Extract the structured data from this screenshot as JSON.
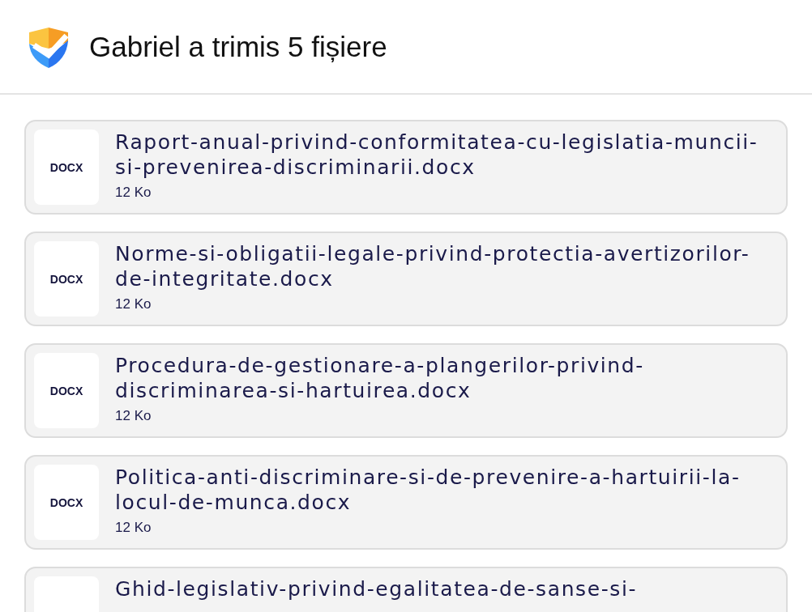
{
  "header": {
    "title": "Gabriel a trimis 5 fișiere"
  },
  "files": [
    {
      "type": "DOCX",
      "name": "Raport-anual-privind-conformitatea-cu-legislatia-muncii-si-prevenirea-discriminarii.docx",
      "size": "12 Ko"
    },
    {
      "type": "DOCX",
      "name": "Norme-si-obligatii-legale-privind-protectia-avertizorilor-de-integritate.docx",
      "size": "12 Ko"
    },
    {
      "type": "DOCX",
      "name": "Procedura-de-gestionare-a-plangerilor-privind-discriminarea-si-hartuirea.docx",
      "size": "12 Ko"
    },
    {
      "type": "DOCX",
      "name": "Politica-anti-discriminare-si-de-prevenire-a-hartuirii-la-locul-de-munca.docx",
      "size": "12 Ko"
    },
    {
      "name": "Ghid-legislativ-privind-egalitatea-de-sanse-si-"
    }
  ]
}
